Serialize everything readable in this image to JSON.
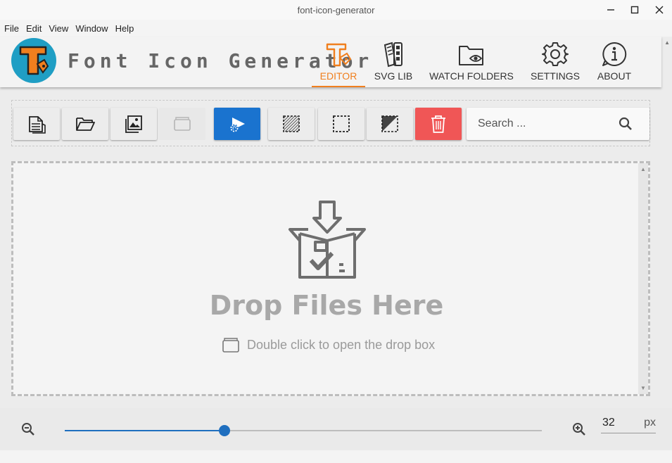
{
  "window": {
    "title": "font-icon-generator",
    "minimize": "─",
    "maximize": "☐",
    "close": "✕"
  },
  "menu": [
    "File",
    "Edit",
    "View",
    "Window",
    "Help"
  ],
  "header": {
    "app_name": "Font Icon Generator",
    "nav": [
      {
        "label": "EDITOR",
        "icon": "editor-icon",
        "active": true
      },
      {
        "label": "SVG LIB",
        "icon": "svg-library-icon",
        "active": false
      },
      {
        "label": "WATCH FOLDERS",
        "icon": "watch-folder-icon",
        "active": false
      },
      {
        "label": "SETTINGS",
        "icon": "gear-icon",
        "active": false
      },
      {
        "label": "ABOUT",
        "icon": "info-icon",
        "active": false
      }
    ]
  },
  "toolbar": {
    "buttons": [
      {
        "name": "new-file",
        "icon": "file-stack-icon"
      },
      {
        "name": "open-folder",
        "icon": "folder-open-icon"
      },
      {
        "name": "open-images",
        "icon": "image-stack-icon"
      },
      {
        "name": "drop-box",
        "icon": "drop-box-icon",
        "disabled": true
      },
      {
        "name": "generate",
        "icon": "generate-font-icon",
        "style": "primary"
      },
      {
        "name": "select-all",
        "icon": "select-all-icon"
      },
      {
        "name": "select-none",
        "icon": "select-none-icon"
      },
      {
        "name": "invert-selection",
        "icon": "invert-selection-icon"
      },
      {
        "name": "delete",
        "icon": "trash-icon",
        "style": "danger"
      }
    ],
    "search_placeholder": "Search ..."
  },
  "dropzone": {
    "title": "Drop Files Here",
    "hint": "Double click to open the drop box"
  },
  "zoom": {
    "value": "32",
    "unit": "px",
    "slider_fraction": 0.335
  },
  "colors": {
    "accent": "#f07f1e",
    "primary": "#1a73cf",
    "danger": "#f05656",
    "logo_bg": "#1f9ec4"
  }
}
